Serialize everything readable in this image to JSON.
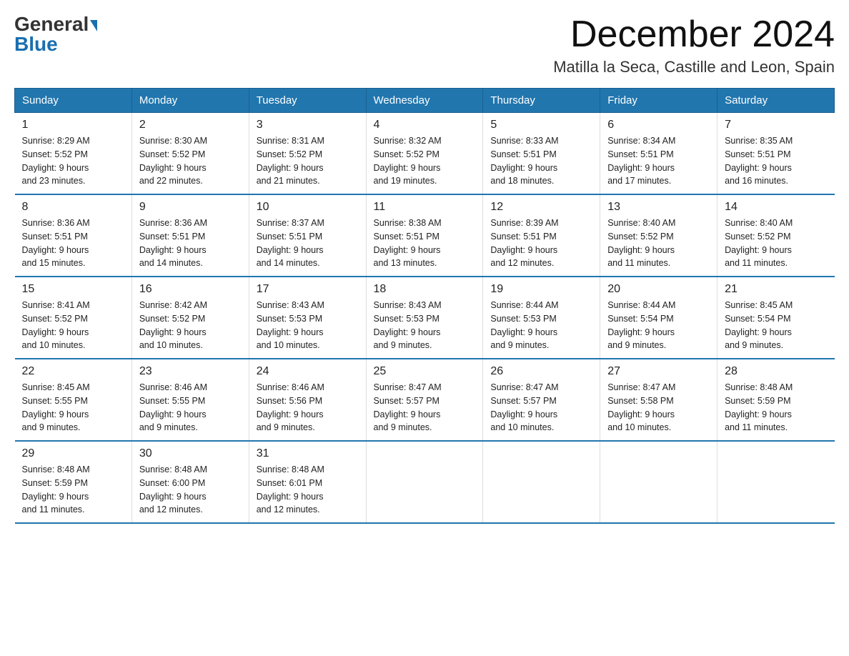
{
  "logo": {
    "general": "General",
    "blue": "Blue"
  },
  "title": "December 2024",
  "subtitle": "Matilla la Seca, Castille and Leon, Spain",
  "days_of_week": [
    "Sunday",
    "Monday",
    "Tuesday",
    "Wednesday",
    "Thursday",
    "Friday",
    "Saturday"
  ],
  "weeks": [
    [
      {
        "day": "1",
        "sunrise": "8:29 AM",
        "sunset": "5:52 PM",
        "daylight": "9 hours and 23 minutes."
      },
      {
        "day": "2",
        "sunrise": "8:30 AM",
        "sunset": "5:52 PM",
        "daylight": "9 hours and 22 minutes."
      },
      {
        "day": "3",
        "sunrise": "8:31 AM",
        "sunset": "5:52 PM",
        "daylight": "9 hours and 21 minutes."
      },
      {
        "day": "4",
        "sunrise": "8:32 AM",
        "sunset": "5:52 PM",
        "daylight": "9 hours and 19 minutes."
      },
      {
        "day": "5",
        "sunrise": "8:33 AM",
        "sunset": "5:51 PM",
        "daylight": "9 hours and 18 minutes."
      },
      {
        "day": "6",
        "sunrise": "8:34 AM",
        "sunset": "5:51 PM",
        "daylight": "9 hours and 17 minutes."
      },
      {
        "day": "7",
        "sunrise": "8:35 AM",
        "sunset": "5:51 PM",
        "daylight": "9 hours and 16 minutes."
      }
    ],
    [
      {
        "day": "8",
        "sunrise": "8:36 AM",
        "sunset": "5:51 PM",
        "daylight": "9 hours and 15 minutes."
      },
      {
        "day": "9",
        "sunrise": "8:36 AM",
        "sunset": "5:51 PM",
        "daylight": "9 hours and 14 minutes."
      },
      {
        "day": "10",
        "sunrise": "8:37 AM",
        "sunset": "5:51 PM",
        "daylight": "9 hours and 14 minutes."
      },
      {
        "day": "11",
        "sunrise": "8:38 AM",
        "sunset": "5:51 PM",
        "daylight": "9 hours and 13 minutes."
      },
      {
        "day": "12",
        "sunrise": "8:39 AM",
        "sunset": "5:51 PM",
        "daylight": "9 hours and 12 minutes."
      },
      {
        "day": "13",
        "sunrise": "8:40 AM",
        "sunset": "5:52 PM",
        "daylight": "9 hours and 11 minutes."
      },
      {
        "day": "14",
        "sunrise": "8:40 AM",
        "sunset": "5:52 PM",
        "daylight": "9 hours and 11 minutes."
      }
    ],
    [
      {
        "day": "15",
        "sunrise": "8:41 AM",
        "sunset": "5:52 PM",
        "daylight": "9 hours and 10 minutes."
      },
      {
        "day": "16",
        "sunrise": "8:42 AM",
        "sunset": "5:52 PM",
        "daylight": "9 hours and 10 minutes."
      },
      {
        "day": "17",
        "sunrise": "8:43 AM",
        "sunset": "5:53 PM",
        "daylight": "9 hours and 10 minutes."
      },
      {
        "day": "18",
        "sunrise": "8:43 AM",
        "sunset": "5:53 PM",
        "daylight": "9 hours and 9 minutes."
      },
      {
        "day": "19",
        "sunrise": "8:44 AM",
        "sunset": "5:53 PM",
        "daylight": "9 hours and 9 minutes."
      },
      {
        "day": "20",
        "sunrise": "8:44 AM",
        "sunset": "5:54 PM",
        "daylight": "9 hours and 9 minutes."
      },
      {
        "day": "21",
        "sunrise": "8:45 AM",
        "sunset": "5:54 PM",
        "daylight": "9 hours and 9 minutes."
      }
    ],
    [
      {
        "day": "22",
        "sunrise": "8:45 AM",
        "sunset": "5:55 PM",
        "daylight": "9 hours and 9 minutes."
      },
      {
        "day": "23",
        "sunrise": "8:46 AM",
        "sunset": "5:55 PM",
        "daylight": "9 hours and 9 minutes."
      },
      {
        "day": "24",
        "sunrise": "8:46 AM",
        "sunset": "5:56 PM",
        "daylight": "9 hours and 9 minutes."
      },
      {
        "day": "25",
        "sunrise": "8:47 AM",
        "sunset": "5:57 PM",
        "daylight": "9 hours and 9 minutes."
      },
      {
        "day": "26",
        "sunrise": "8:47 AM",
        "sunset": "5:57 PM",
        "daylight": "9 hours and 10 minutes."
      },
      {
        "day": "27",
        "sunrise": "8:47 AM",
        "sunset": "5:58 PM",
        "daylight": "9 hours and 10 minutes."
      },
      {
        "day": "28",
        "sunrise": "8:48 AM",
        "sunset": "5:59 PM",
        "daylight": "9 hours and 11 minutes."
      }
    ],
    [
      {
        "day": "29",
        "sunrise": "8:48 AM",
        "sunset": "5:59 PM",
        "daylight": "9 hours and 11 minutes."
      },
      {
        "day": "30",
        "sunrise": "8:48 AM",
        "sunset": "6:00 PM",
        "daylight": "9 hours and 12 minutes."
      },
      {
        "day": "31",
        "sunrise": "8:48 AM",
        "sunset": "6:01 PM",
        "daylight": "9 hours and 12 minutes."
      },
      null,
      null,
      null,
      null
    ]
  ]
}
